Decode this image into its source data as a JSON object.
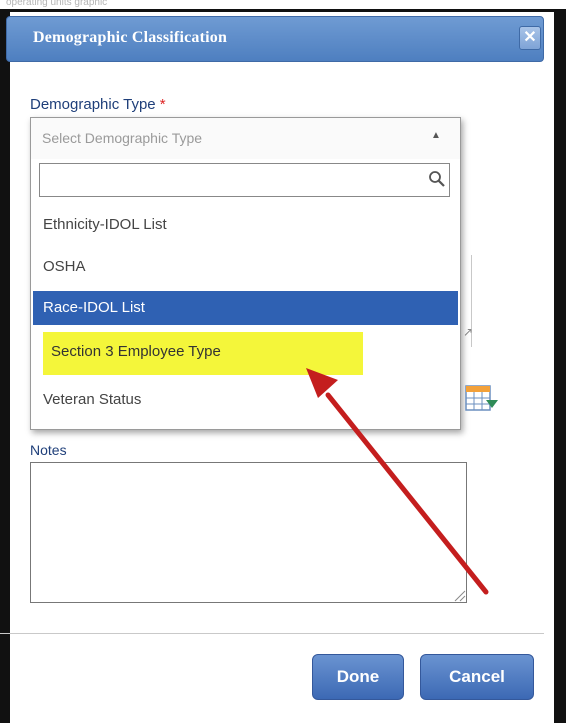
{
  "page_caption": "operating units graphic",
  "dialog": {
    "title": "Demographic Classification",
    "close_glyph": "✕"
  },
  "demographic_field": {
    "label": "Demographic Type",
    "required_marker": "*",
    "placeholder": "Select Demographic Type",
    "search_placeholder": "",
    "options": [
      "Ethnicity-IDOL List",
      "OSHA",
      "Race-IDOL List",
      "Section 3 Employee Type",
      "Veteran Status"
    ],
    "highlighted_option": "Race-IDOL List",
    "annotated_option": "Section 3 Employee Type"
  },
  "notes": {
    "label": "Notes",
    "value": ""
  },
  "footer": {
    "done_label": "Done",
    "cancel_label": "Cancel"
  },
  "icons": {
    "search": "search-icon",
    "calendar": "calendar-grid-icon",
    "dropdown_caret": "caret-up-icon"
  },
  "colors": {
    "titlebar": "#5b89c8",
    "selected_option": "#2f61b3",
    "annotation_highlight": "#f4f63a",
    "annotation_arrow": "#c41e1e",
    "button": "#4d7ac0"
  }
}
